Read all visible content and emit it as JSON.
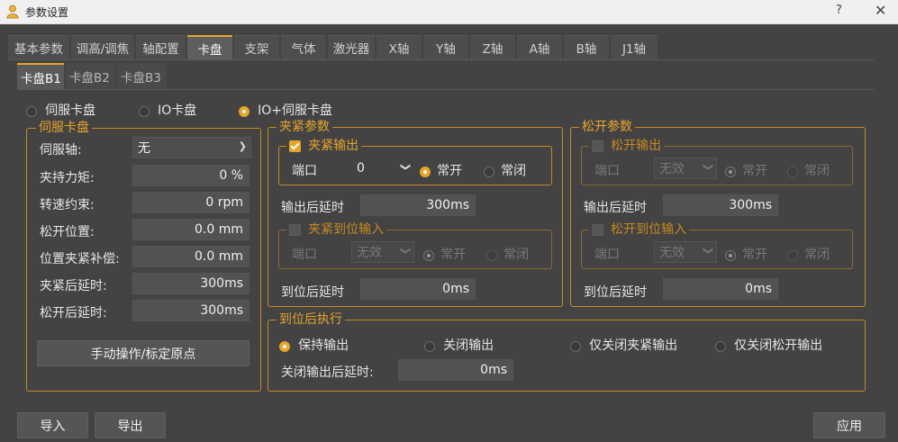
{
  "window": {
    "title": "参数设置",
    "help": "?",
    "close": "✕"
  },
  "tabs": [
    "基本参数",
    "调高/调焦",
    "轴配置",
    "卡盘",
    "支架",
    "气体",
    "激光器",
    "X轴",
    "Y轴",
    "Z轴",
    "A轴",
    "B轴",
    "J1轴"
  ],
  "subtabs": [
    "卡盘B1",
    "卡盘B2",
    "卡盘B3"
  ],
  "card_type": {
    "options": [
      "伺服卡盘",
      "IO卡盘",
      "IO+伺服卡盘"
    ],
    "selected": "IO+伺服卡盘"
  },
  "servo": {
    "legend": "伺服卡盘",
    "axis_label": "伺服轴:",
    "axis_value": "无",
    "torque_label": "夹持力矩:",
    "torque_value": "0 %",
    "speed_label": "转速约束:",
    "speed_value": "0 rpm",
    "release_pos_label": "松开位置:",
    "release_pos_value": "0.0 mm",
    "comp_label": "位置夹紧补偿:",
    "comp_value": "0.0 mm",
    "clamp_delay_label": "夹紧后延时:",
    "clamp_delay_value": "300ms",
    "release_delay_label": "松开后延时:",
    "release_delay_value": "300ms",
    "manual_button": "手动操作/标定原点"
  },
  "clamp": {
    "legend": "夹紧参数",
    "output_legend": "夹紧输出",
    "port_label": "端口",
    "port_value": "0",
    "no": "常开",
    "nc": "常闭",
    "out_delay_label": "输出后延时",
    "out_delay_value": "300ms",
    "inpos_legend": "夹紧到位输入",
    "inpos_port_value": "无效",
    "inpos_delay_label": "到位后延时",
    "inpos_delay_value": "0ms"
  },
  "release": {
    "legend": "松开参数",
    "output_legend": "松开输出",
    "port_label": "端口",
    "port_value": "无效",
    "no": "常开",
    "nc": "常闭",
    "out_delay_label": "输出后延时",
    "out_delay_value": "300ms",
    "inpos_legend": "松开到位输入",
    "inpos_port_value": "无效",
    "inpos_delay_label": "到位后延时",
    "inpos_delay_value": "0ms"
  },
  "after": {
    "legend": "到位后执行",
    "options": [
      "保持输出",
      "关闭输出",
      "仅关闭夹紧输出",
      "仅关闭松开输出"
    ],
    "selected": "保持输出",
    "close_delay_label": "关闭输出后延时:",
    "close_delay_value": "0ms"
  },
  "footer": {
    "import": "导入",
    "export": "导出",
    "apply": "应用"
  },
  "colors": {
    "accent": "#e7a528",
    "background": "#434343"
  }
}
